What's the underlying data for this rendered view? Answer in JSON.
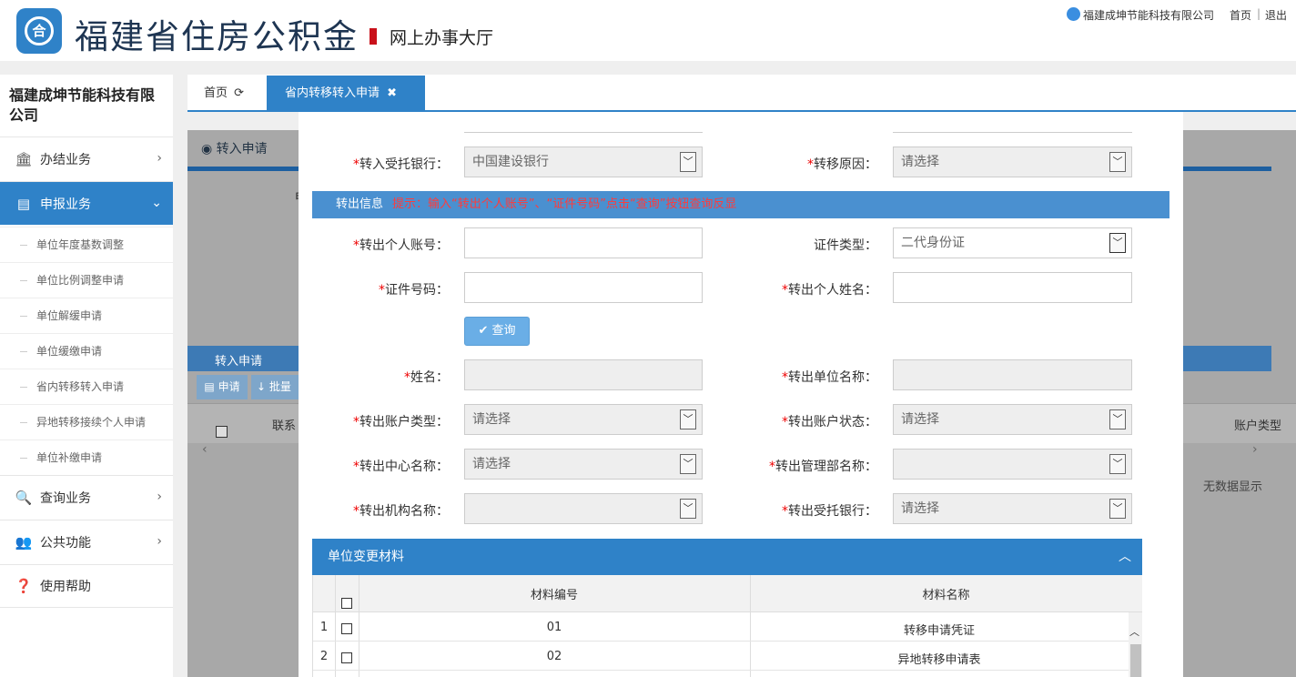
{
  "header": {
    "title": "福建省住房公积金",
    "subtitle": "网上办事大厅",
    "company": "福建成坤节能科技有限公司",
    "home_link": "首页",
    "separator": "|",
    "logout_link": "退出"
  },
  "sidebar": {
    "company_name": "福建成坤节能科技有限公司",
    "items": [
      {
        "label": "办结业务",
        "icon": "bank-icon"
      },
      {
        "label": "申报业务",
        "icon": "briefcase-icon"
      },
      {
        "label": "查询业务",
        "icon": "search-icon"
      },
      {
        "label": "公共功能",
        "icon": "users-icon"
      },
      {
        "label": "使用帮助",
        "icon": "help-icon"
      }
    ],
    "subitems": [
      "单位年度基数调整",
      "单位比例调整申请",
      "单位解缓申请",
      "单位缓缴申请",
      "省内转移转入申请",
      "异地转移接续个人申请",
      "单位补缴申请"
    ]
  },
  "tabs": {
    "home": "首页",
    "active": "省内转移转入申请"
  },
  "background": {
    "section_title": "转入申请",
    "char_e": "申",
    "panel_title": "转入申请",
    "apply_button": "申请",
    "batch_button": "批量",
    "col_contact": "联系",
    "col_account_type": "账户类型",
    "no_data": "无数据显示"
  },
  "form": {
    "in_bank_label": "转入受托银行：",
    "in_bank_value": "中国建设银行",
    "reason_label": "转移原因：",
    "reason_value": "请选择",
    "out_info_title": "转出信息",
    "out_info_tip": "提示：输入“转出个人账号”、“证件号码”点击“查询”按钮查询反显",
    "out_account_label": "转出个人账号：",
    "out_account_value": "",
    "id_type_label": "证件类型：",
    "id_type_value": "二代身份证",
    "id_number_label": "证件号码：",
    "id_number_value": "",
    "out_name_label": "转出个人姓名：",
    "out_name_value": "",
    "query_button": "查询",
    "name_label": "姓名：",
    "name_value": "",
    "out_unit_label": "转出单位名称：",
    "out_unit_value": "",
    "out_acct_type_label": "转出账户类型：",
    "out_acct_type_value": "请选择",
    "out_acct_status_label": "转出账户状态：",
    "out_acct_status_value": "请选择",
    "out_center_label": "转出中心名称：",
    "out_center_value": "请选择",
    "out_dept_label": "转出管理部名称：",
    "out_dept_value": "",
    "out_org_label": "转出机构名称：",
    "out_org_value": "",
    "out_bank_label": "转出受托银行：",
    "out_bank_value": "请选择"
  },
  "materials": {
    "title": "单位变更材料",
    "col_code": "材料编号",
    "col_name": "材料名称",
    "rows": [
      {
        "index": "1",
        "code": "01",
        "name": "转移申请凭证"
      },
      {
        "index": "2",
        "code": "02",
        "name": "异地转移申请表"
      }
    ]
  },
  "colors": {
    "primary": "#2f82c8",
    "banner": "#4a90d0",
    "required": "#e00000",
    "tip": "#ff3b3b"
  }
}
